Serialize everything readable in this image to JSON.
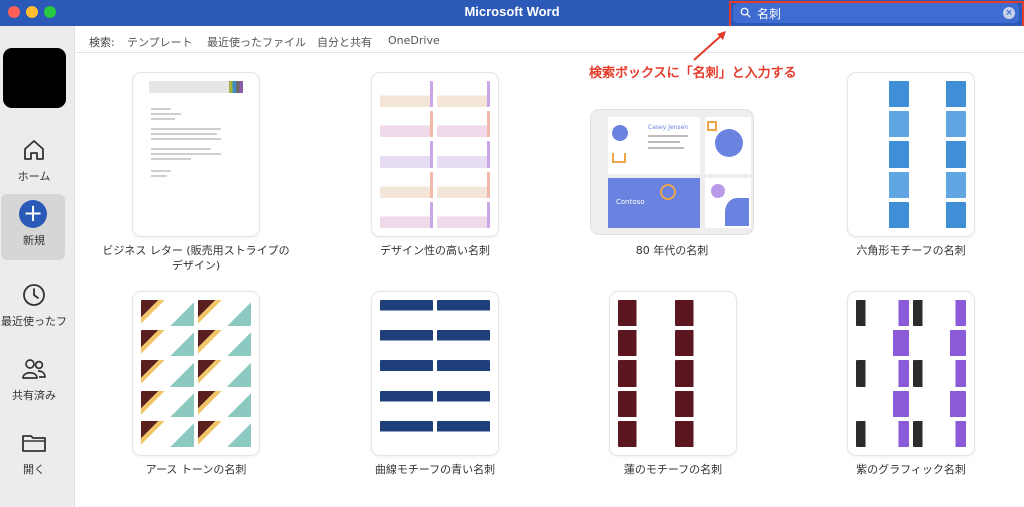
{
  "window": {
    "title": "Microsoft Word"
  },
  "search": {
    "value": "名刺",
    "clear_symbol": "×"
  },
  "sidebar": {
    "items": [
      {
        "label": "ホーム",
        "icon": "home-icon"
      },
      {
        "label": "新規",
        "icon": "plus-icon",
        "active": true,
        "plus_symbol": "+"
      },
      {
        "label": "最近使ったファ",
        "icon": "clock-icon"
      },
      {
        "label": "共有済み",
        "icon": "people-icon"
      },
      {
        "label": "開く",
        "icon": "folder-icon"
      }
    ]
  },
  "filters": {
    "label": "検索:",
    "items": [
      "テンプレート",
      "最近使ったファイル",
      "自分と共有",
      "OneDrive"
    ]
  },
  "annotation": {
    "text": "検索ボックスに「名刺」と入力する"
  },
  "templates": [
    {
      "label": "ビジネス レター (販売用ストライプのデザイン)"
    },
    {
      "label": "デザイン性の高い名刺"
    },
    {
      "label": "80 年代の名刺",
      "card_name": "Casey Jensen",
      "card_brand": "Contoso"
    },
    {
      "label": "六角形モチーフの名刺"
    },
    {
      "label": "アース トーンの名刺"
    },
    {
      "label": "曲線モチーフの青い名刺"
    },
    {
      "label": "蓮のモチーフの名刺"
    },
    {
      "label": "紫のグラフィック名刺"
    }
  ],
  "colors": {
    "titlebar": "#2b59b7",
    "accent": "#2b59b7",
    "annotation": "#e43b2b"
  }
}
